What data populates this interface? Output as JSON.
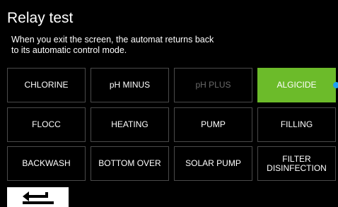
{
  "header": {
    "title": "Relay test",
    "info_line_1": "When you exit the screen, the automat returns back",
    "info_line_2": "to its automatic control mode."
  },
  "relays": [
    {
      "label": "CHLORINE",
      "state": "normal"
    },
    {
      "label": "pH MINUS",
      "state": "normal"
    },
    {
      "label": "pH PLUS",
      "state": "disabled"
    },
    {
      "label": "ALGICIDE",
      "state": "active"
    },
    {
      "label": "FLOCC",
      "state": "normal"
    },
    {
      "label": "HEATING",
      "state": "normal"
    },
    {
      "label": "PUMP",
      "state": "normal"
    },
    {
      "label": "FILLING",
      "state": "normal"
    },
    {
      "label": "BACKWASH",
      "state": "normal"
    },
    {
      "label": "BOTTOM OVER",
      "state": "normal"
    },
    {
      "label": "SOLAR PUMP",
      "state": "normal"
    },
    {
      "label": "FILTER DISINFECTION",
      "label_line_1": "FILTER",
      "label_line_2": "DISINFECTION",
      "state": "normal"
    }
  ],
  "footer": {
    "back_icon": "return-arrow-icon"
  },
  "colors": {
    "background": "#000000",
    "active": "#6cbb2a",
    "indicator": "#1e9ff2",
    "disabled_text": "#6a6a6a",
    "border": "#4a4a4a"
  }
}
